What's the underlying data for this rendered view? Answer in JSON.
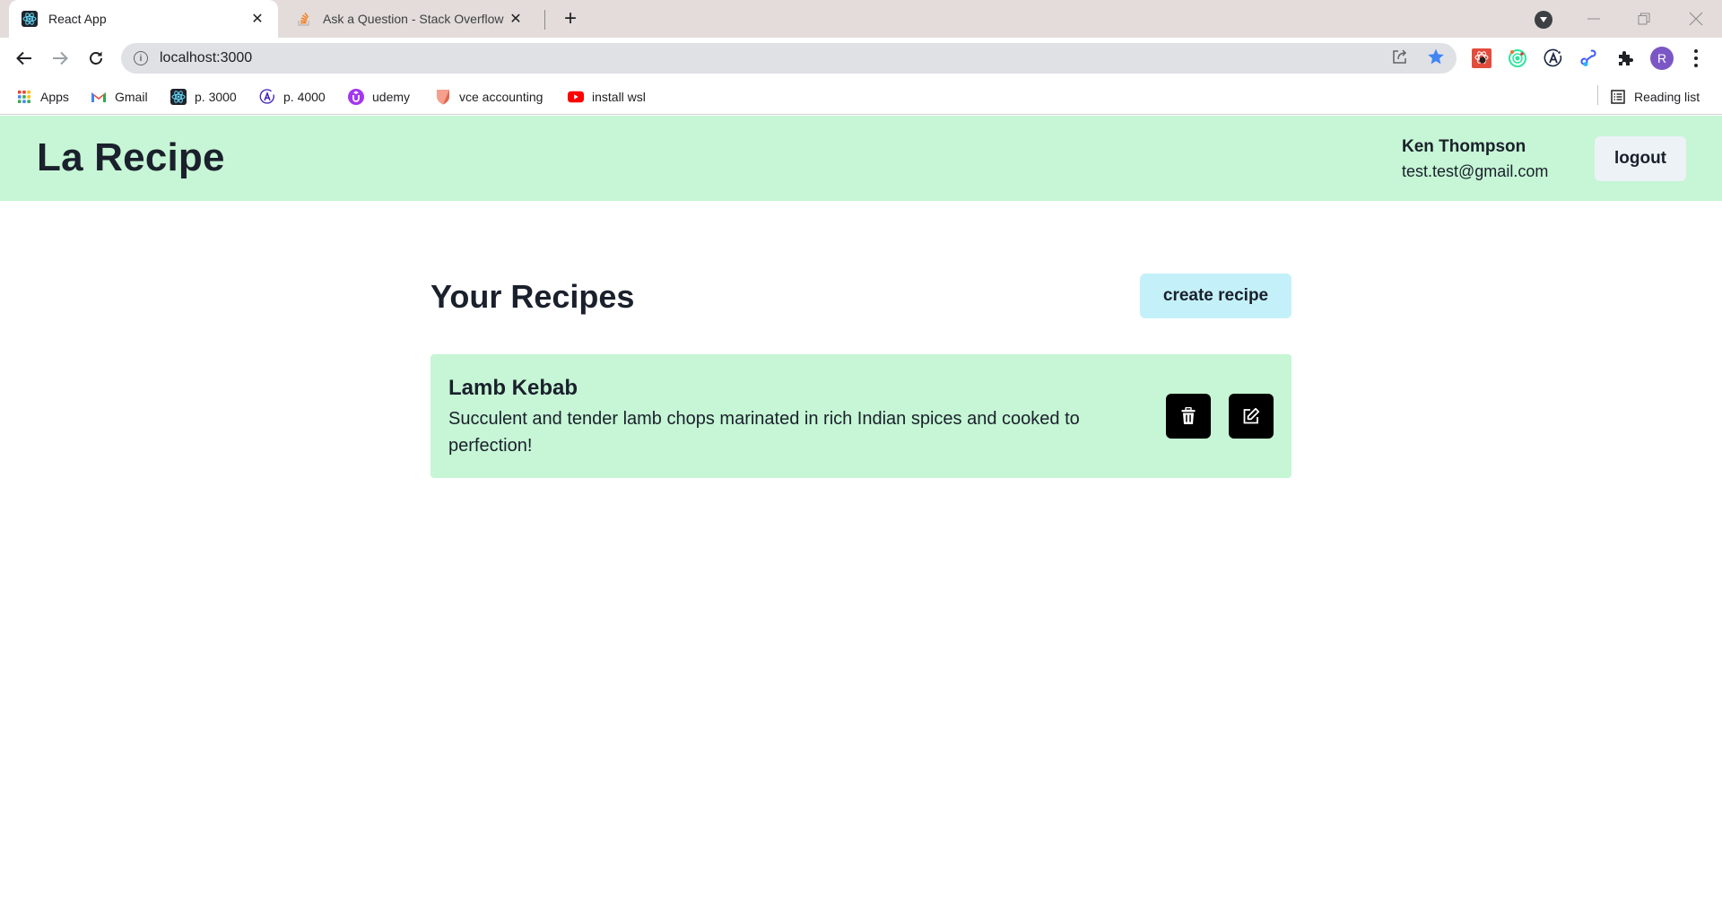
{
  "browser": {
    "tabs": [
      {
        "title": "React App",
        "icon": "react-icon",
        "active": true
      },
      {
        "title": "Ask a Question - Stack Overflow",
        "icon": "stackoverflow-icon",
        "active": false
      }
    ],
    "new_tab_label": "+",
    "address": {
      "url": "localhost:3000"
    },
    "bookmarks": [
      {
        "label": "Apps",
        "icon": "apps-grid-icon"
      },
      {
        "label": "Gmail",
        "icon": "gmail-icon"
      },
      {
        "label": "p. 3000",
        "icon": "react-icon"
      },
      {
        "label": "p. 4000",
        "icon": "apollo-icon"
      },
      {
        "label": "udemy",
        "icon": "udemy-icon"
      },
      {
        "label": "vce accounting",
        "icon": "shield-icon"
      },
      {
        "label": "install wsl",
        "icon": "youtube-icon"
      }
    ],
    "reading_list_label": "Reading list",
    "profile_initial": "R",
    "colors": {
      "star": "#4285f4",
      "avatar": "#7b57c5"
    }
  },
  "app": {
    "brand": "La Recipe",
    "user": {
      "name": "Ken Thompson",
      "email": "test.test@gmail.com"
    },
    "logout_label": "logout",
    "heading": "Your Recipes",
    "create_label": "create recipe",
    "recipes": [
      {
        "title": "Lamb Kebab",
        "description": "Succulent and tender lamb chops marinated in rich Indian spices and cooked to perfection!"
      }
    ],
    "colors": {
      "header_bg": "#c6f6d5",
      "card_bg": "#c6f6d5",
      "create_button_bg": "#c4f1f9",
      "logout_button_bg": "#edf2f7",
      "icon_button_bg": "#000000",
      "text": "#1a202c"
    }
  }
}
